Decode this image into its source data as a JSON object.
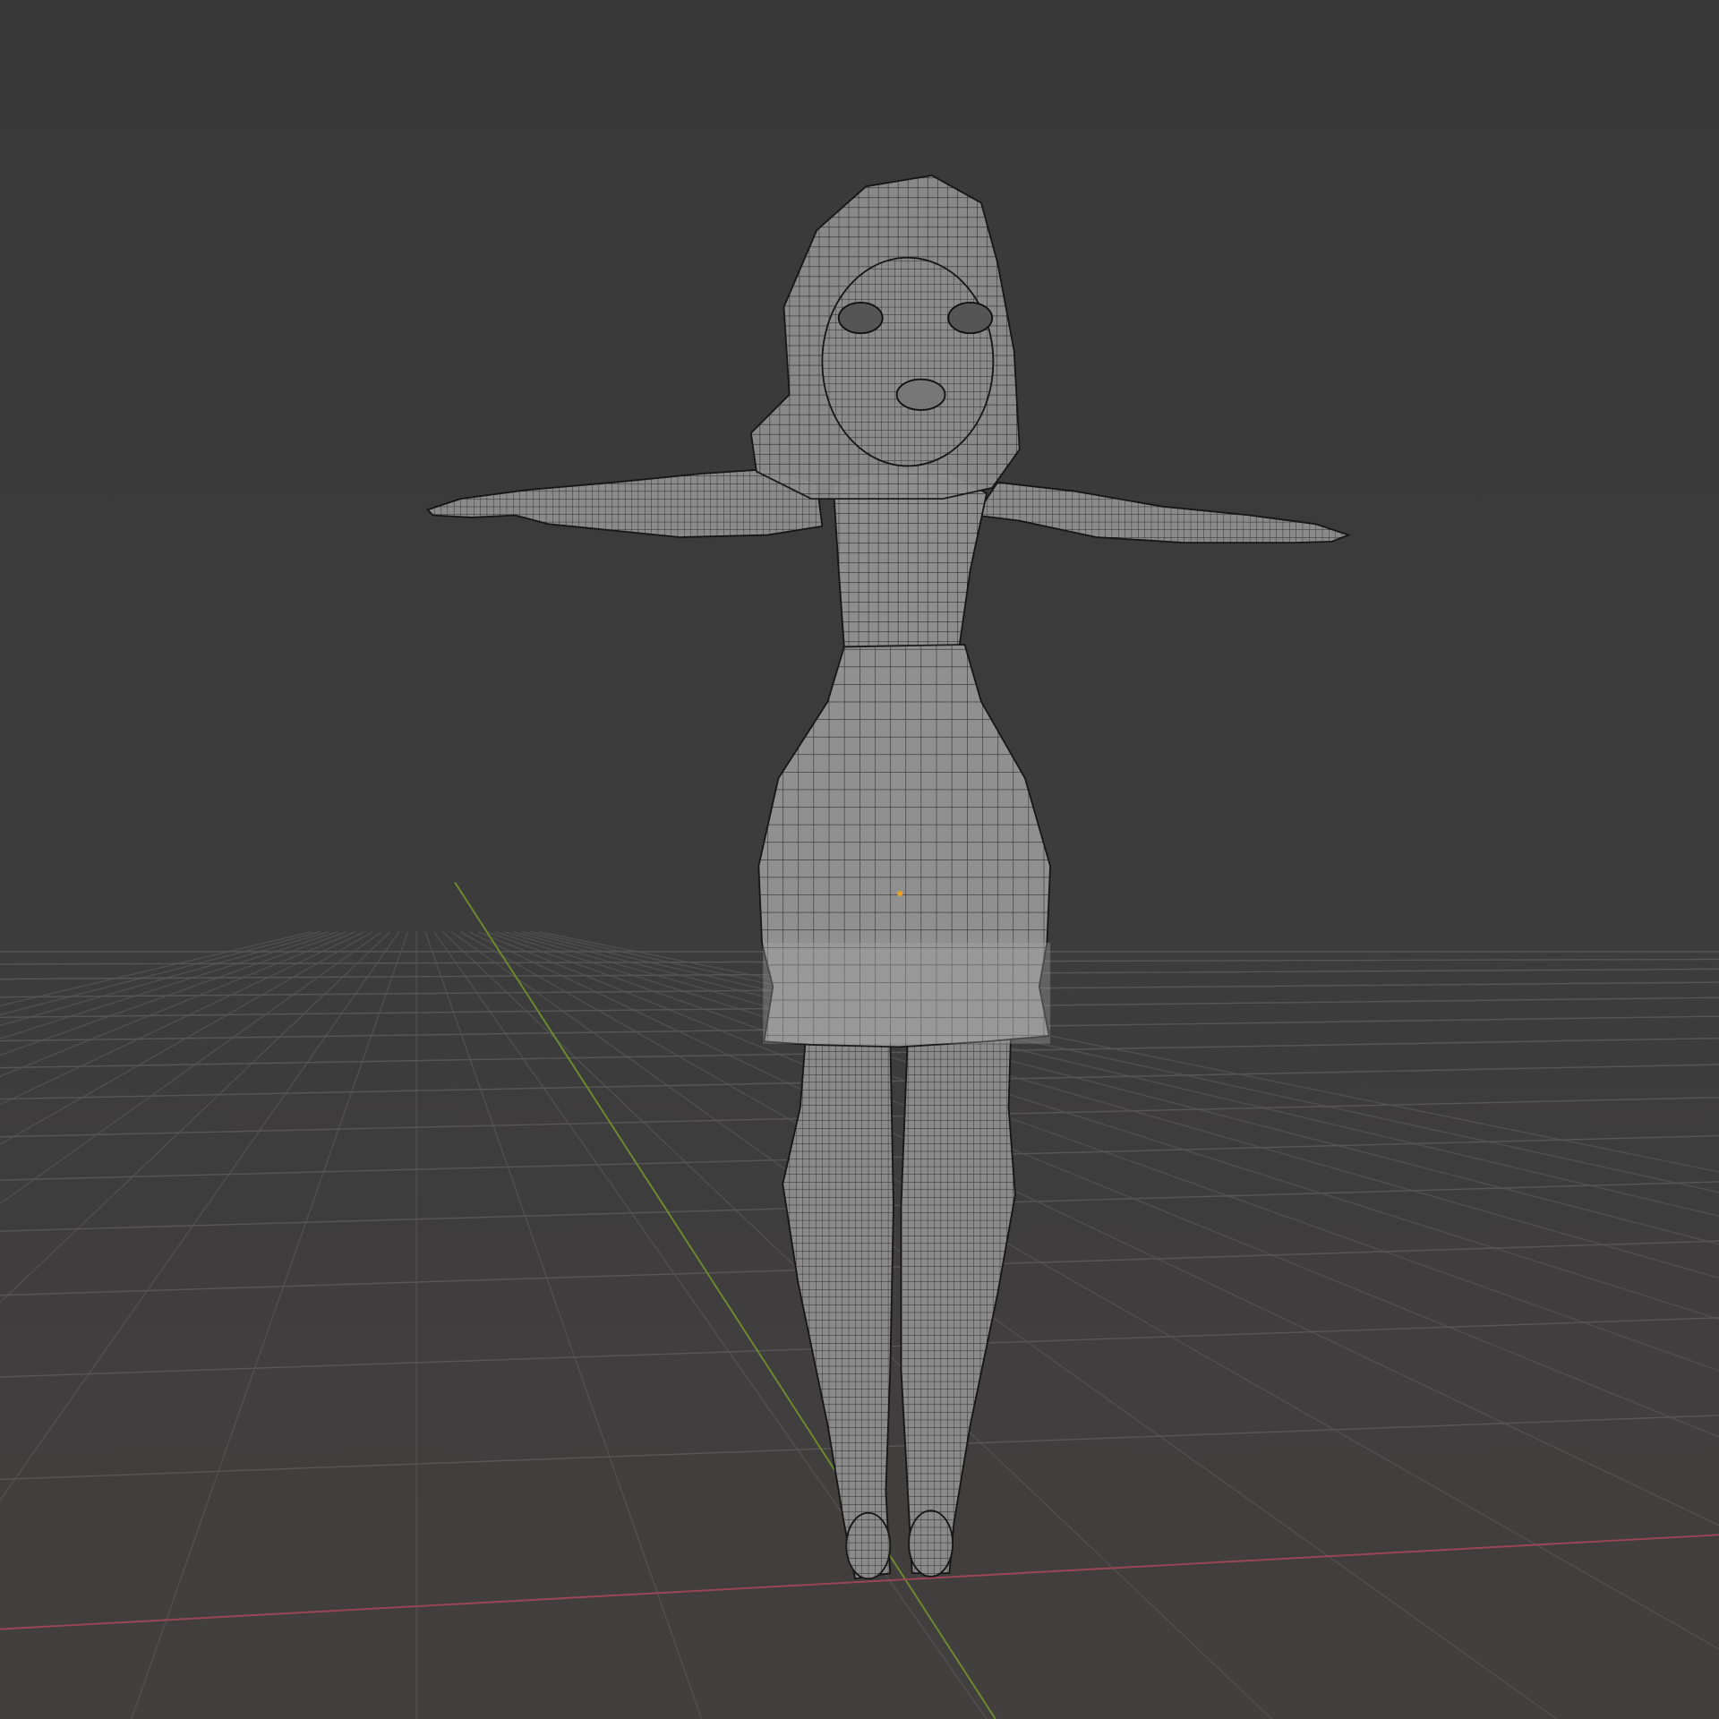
{
  "viewport": {
    "mode": "wireframe-overlay",
    "colors": {
      "background_top": "#3a3a3a",
      "background_bottom": "#444040",
      "grid": "#555555",
      "x_axis": "#9a4656",
      "y_axis": "#6d8a2c",
      "mesh_fill": "#8f8f8f",
      "wire": "#1e1e1e",
      "origin": "#f0a020"
    }
  }
}
